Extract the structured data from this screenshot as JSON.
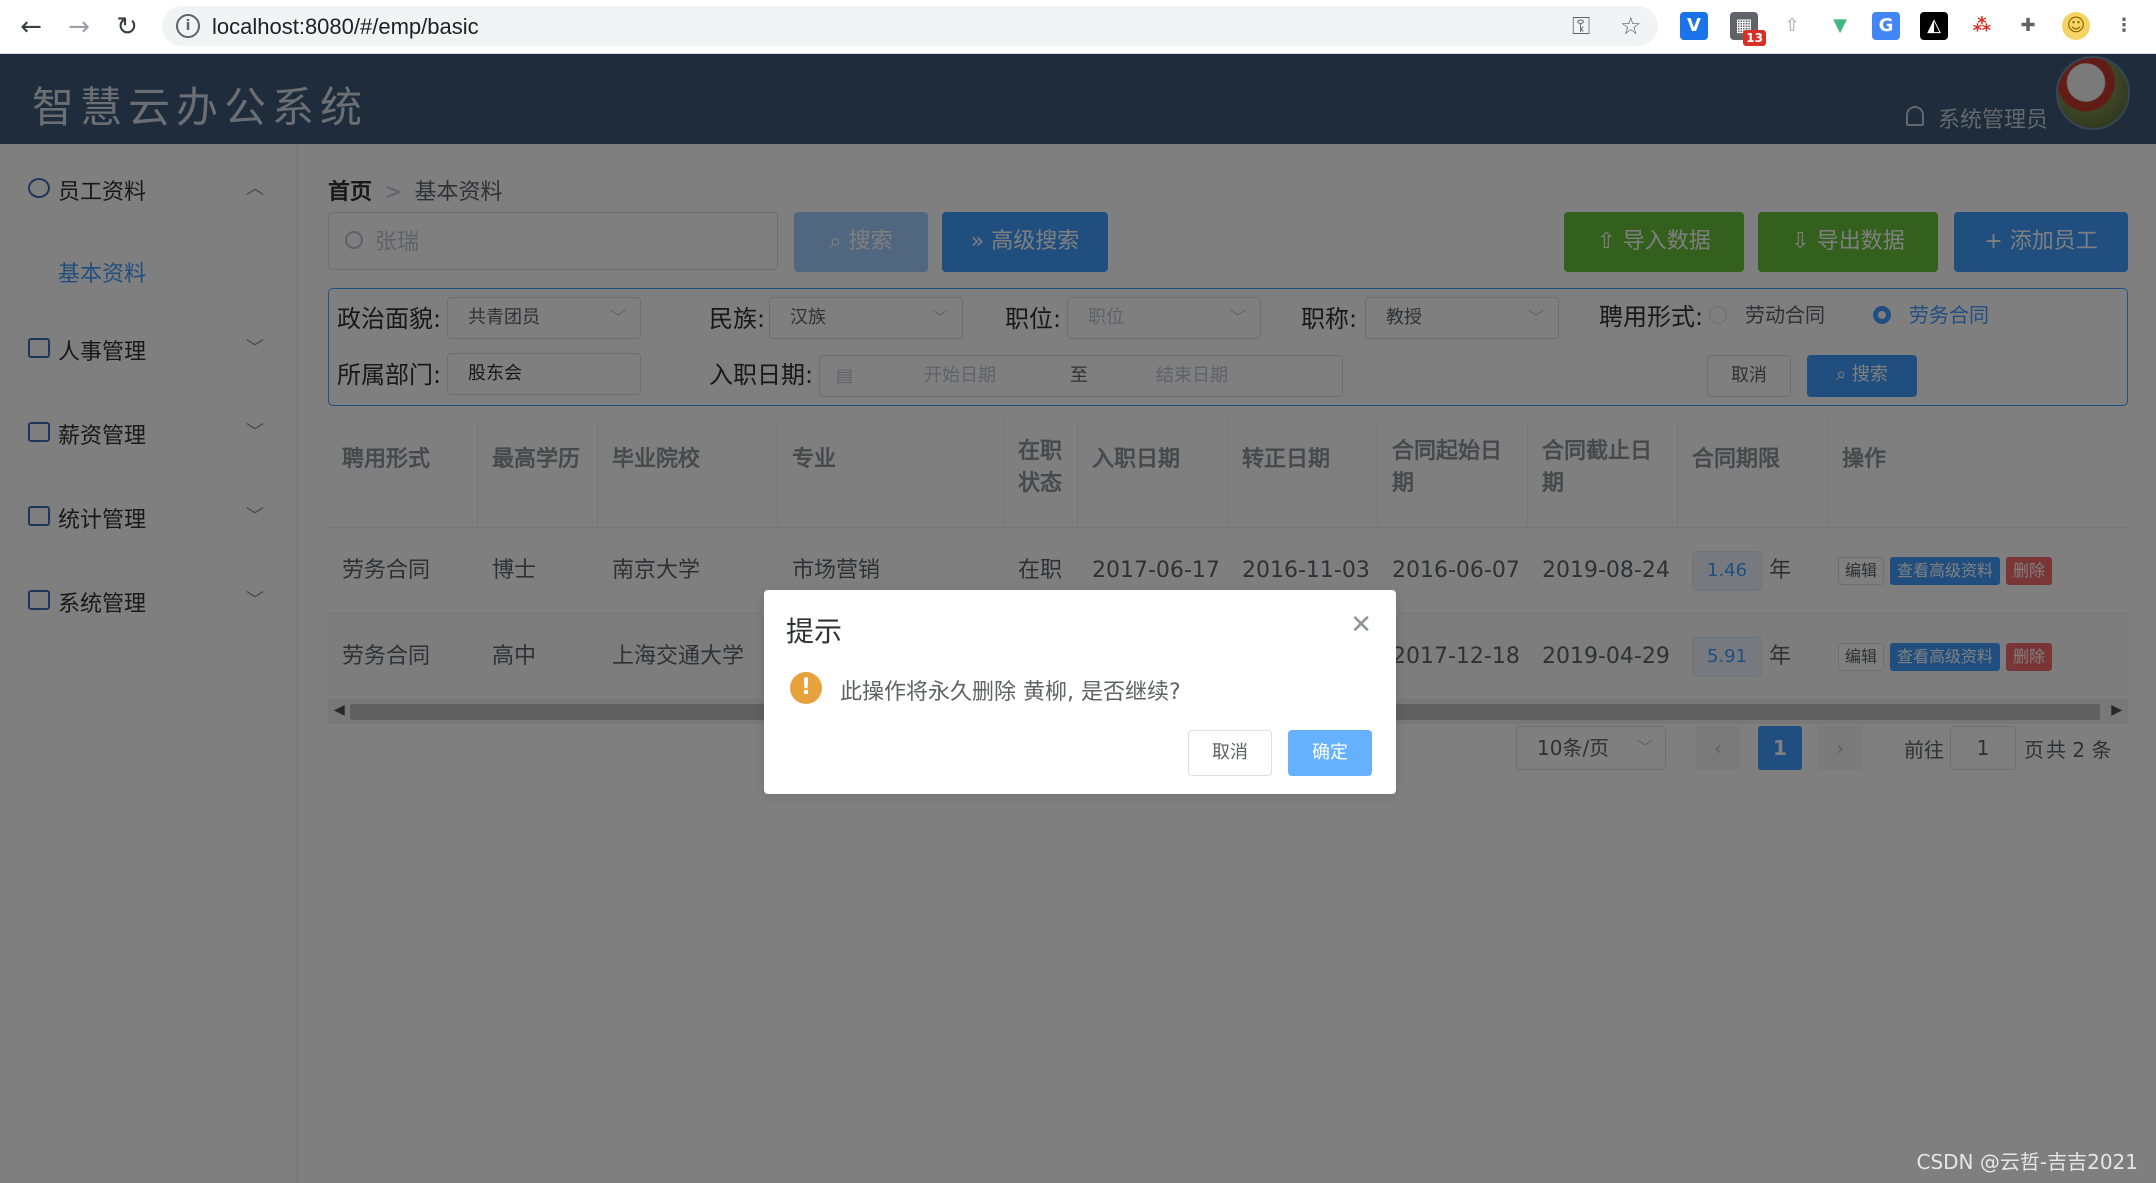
{
  "browser": {
    "url": "localhost:8080/#/emp/basic",
    "badge": "13"
  },
  "app": {
    "title": "智慧云办公系统",
    "user": "系统管理员"
  },
  "sidebar": {
    "items": [
      {
        "label": "员工资料",
        "expanded": true,
        "sub": [
          "基本资料"
        ]
      },
      {
        "label": "人事管理"
      },
      {
        "label": "薪资管理"
      },
      {
        "label": "统计管理"
      },
      {
        "label": "系统管理"
      }
    ]
  },
  "breadcrumb": {
    "home": "首页",
    "current": "基本资料"
  },
  "toolbar": {
    "search_placeholder": "张瑞",
    "search_label": "搜索",
    "advanced_label": "高级搜索",
    "import_label": "导入数据",
    "export_label": "导出数据",
    "add_label": "添加员工"
  },
  "advanced": {
    "political_label": "政治面貌:",
    "political_value": "共青团员",
    "nation_label": "民族:",
    "nation_value": "汉族",
    "position_label": "职位:",
    "position_placeholder": "职位",
    "title_label": "职称:",
    "title_value": "教授",
    "hire_label": "聘用形式:",
    "hire_option1": "劳动合同",
    "hire_option2": "劳务合同",
    "hire_selected": "劳务合同",
    "dept_label": "所属部门:",
    "dept_value": "股东会",
    "date_label": "入职日期:",
    "date_start": "开始日期",
    "date_to": "至",
    "date_end": "结束日期",
    "cancel_label": "取消",
    "search_label": "搜索"
  },
  "table": {
    "headers": [
      "聘用形式",
      "最高学历",
      "毕业院校",
      "专业",
      "在职状态",
      "入职日期",
      "转正日期",
      "合同起始日期",
      "合同截止日期",
      "合同期限",
      "操作"
    ],
    "rows": [
      {
        "hire": "劳务合同",
        "edu": "博士",
        "school": "南京大学",
        "major": "市场营销",
        "status": "在职",
        "join": "2017-06-17",
        "regular": "2016-11-03",
        "cstart": "2016-06-07",
        "cend": "2019-08-24",
        "term": "1.46",
        "unit": "年"
      },
      {
        "hire": "劳务合同",
        "edu": "高中",
        "school": "上海交通大学",
        "major": "",
        "status": "",
        "join": "",
        "regular": "",
        "cstart": "2017-12-18",
        "cend": "2019-04-29",
        "term": "5.91",
        "unit": "年"
      }
    ],
    "actions": {
      "edit": "编辑",
      "view": "查看高级资料",
      "delete": "删除"
    }
  },
  "pagination": {
    "page_size": "10条/页",
    "current": "1",
    "goto_label": "前往",
    "goto_value": "1",
    "page_suffix": "页",
    "total": "共 2 条"
  },
  "dialog": {
    "title": "提示",
    "message": "此操作将永久删除 黄柳, 是否继续?",
    "cancel": "取消",
    "confirm": "确定"
  },
  "watermark": "CSDN @云哲-吉吉2021",
  "colors": {
    "header": "#3d5878",
    "primary": "#409eff",
    "success": "#67c23a",
    "warning": "#e6a23c",
    "danger": "#f56c6c"
  }
}
